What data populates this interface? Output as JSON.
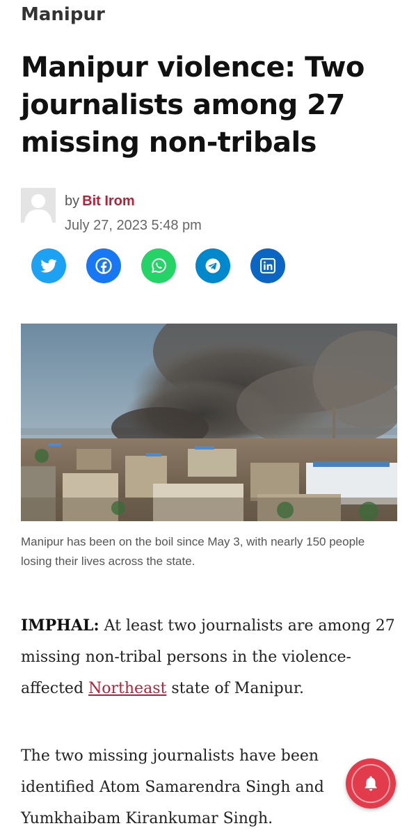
{
  "article": {
    "category": "Manipur",
    "title": "Manipur violence: Two journalists among 27 missing non-tribals",
    "byline_prefix": "by",
    "author": "Bit Irom",
    "date": "July 27, 2023 5:48 pm",
    "image_caption": "Manipur has been on the boil since May 3, with nearly 150 people losing their lives across the state.",
    "body": {
      "p1": {
        "dateline": "IMPHAL:",
        "text_before_link": " At least two journalists are among 27 missing non-tribal persons in the violence-affected ",
        "link_text": "Northeast",
        "text_after_link": " state of Manipur."
      },
      "p2": "The two missing journalists have been identified Atom Samarendra Singh and Yumkhaibam Kirankumar Singh."
    }
  },
  "share_buttons": [
    {
      "name": "twitter",
      "icon": "twitter-bird-icon",
      "color": "#1da1f2"
    },
    {
      "name": "facebook",
      "icon": "facebook-f-icon",
      "color": "#1877f2"
    },
    {
      "name": "whatsapp",
      "icon": "whatsapp-phone-icon",
      "color": "#25d366"
    },
    {
      "name": "telegram",
      "icon": "telegram-plane-icon",
      "color": "#0088cc"
    },
    {
      "name": "linkedin",
      "icon": "linkedin-in-icon",
      "color": "#0a66c2"
    }
  ],
  "notification_button": {
    "icon": "bell-icon",
    "color": "#e23b4b"
  },
  "colors": {
    "accent": "#b0243a"
  }
}
